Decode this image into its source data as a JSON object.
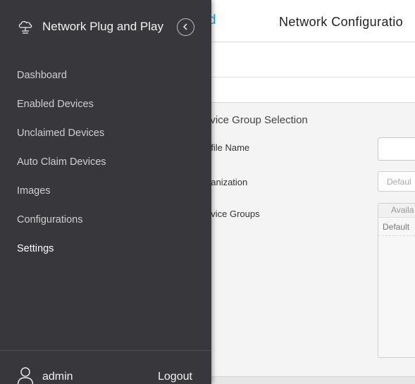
{
  "app": {
    "title": "Network Plug and Play",
    "icon": "cloud-network-icon",
    "collapse_icon": "chevron-left-circle-icon"
  },
  "sidebar": {
    "items": [
      {
        "label": "Dashboard",
        "active": false
      },
      {
        "label": "Enabled Devices",
        "active": false
      },
      {
        "label": "Unclaimed Devices",
        "active": false
      },
      {
        "label": "Auto Claim Devices",
        "active": false
      },
      {
        "label": "Images",
        "active": false
      },
      {
        "label": "Configurations",
        "active": false
      },
      {
        "label": "Settings",
        "active": true
      }
    ],
    "footer": {
      "user_icon": "user-icon",
      "username": "admin",
      "logout_label": "Logout"
    }
  },
  "background": {
    "header_link": "d",
    "page_title": "Network Configuratio",
    "section_title": "evice Group Selection",
    "profile_label": "ofile Name",
    "org_label": "ganization",
    "org_value": "Defaul",
    "groups_label": "evice Groups",
    "groups_header": "Availa",
    "groups_item": "Default"
  },
  "colors": {
    "sidebar_bg": "#38373b",
    "accent": "#1fa0d9",
    "active_text": "#ffffff"
  }
}
